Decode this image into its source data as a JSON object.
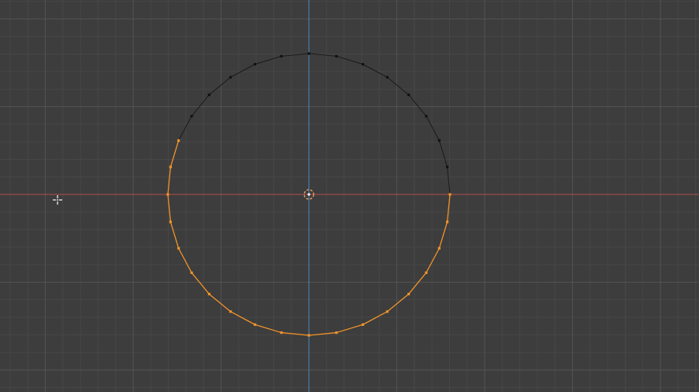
{
  "viewport": {
    "mode": "edit-mode",
    "view": "top-orthographic",
    "background_color": "#3d3d3d",
    "grid_minor_color": "#474747",
    "grid_major_color": "#525252"
  },
  "axes": {
    "x_axis_color": "#9b4a4a",
    "y_axis_color": "#4a7aa6"
  },
  "mesh": {
    "type": "circle",
    "vertex_count": 32,
    "selected_vertex_indices": [
      0,
      1,
      2,
      3,
      4,
      5,
      6,
      7,
      8,
      9,
      10,
      11,
      12,
      13,
      14,
      15,
      16,
      17,
      18
    ],
    "selected_color": "#f0922a",
    "unselected_vertex_color": "#111111",
    "unselected_edge_color": "#1a1a1a"
  },
  "object_origin": {
    "icon": "origin-icon",
    "color": "#f2a36b"
  },
  "cursor": {
    "icon": "move-cursor-icon",
    "color": "#ffffff"
  }
}
